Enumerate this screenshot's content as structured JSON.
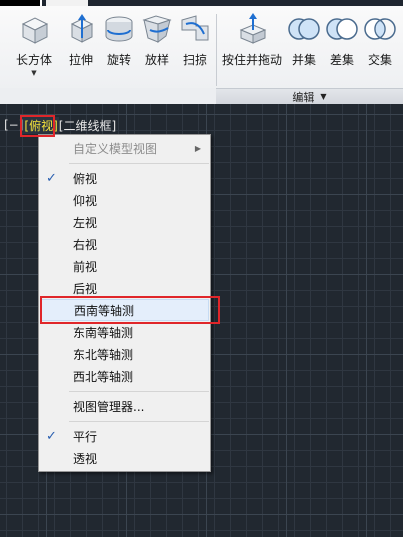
{
  "ribbon": {
    "buttons": [
      {
        "label": "长方体",
        "icon": "box-icon"
      },
      {
        "label": "拉伸",
        "icon": "extrude-icon"
      },
      {
        "label": "旋转",
        "icon": "revolve-icon"
      },
      {
        "label": "放样",
        "icon": "loft-icon"
      },
      {
        "label": "扫掠",
        "icon": "sweep-icon"
      },
      {
        "label": "按住并拖动",
        "icon": "presspull-icon"
      },
      {
        "label": "并集",
        "icon": "union-icon"
      },
      {
        "label": "差集",
        "icon": "subtract-icon"
      },
      {
        "label": "交集",
        "icon": "intersect-icon"
      }
    ],
    "panel_title": "编辑"
  },
  "viewport": {
    "control": "[−]",
    "view": "[俯视]",
    "visual_style": "[二维线框]"
  },
  "menu": {
    "items": [
      {
        "label": "自定义模型视图",
        "checked": false,
        "submenu": true,
        "disabled": true
      },
      {
        "label": "俯视",
        "checked": true
      },
      {
        "label": "仰视",
        "checked": false
      },
      {
        "label": "左视",
        "checked": false
      },
      {
        "label": "右视",
        "checked": false
      },
      {
        "label": "前视",
        "checked": false
      },
      {
        "label": "后视",
        "checked": false
      },
      {
        "label": "西南等轴测",
        "checked": false,
        "highlighted": true
      },
      {
        "label": "东南等轴测",
        "checked": false
      },
      {
        "label": "东北等轴测",
        "checked": false
      },
      {
        "label": "西北等轴测",
        "checked": false
      },
      {
        "label": "视图管理器...",
        "checked": false
      },
      {
        "label": "平行",
        "checked": true
      },
      {
        "label": "透视",
        "checked": false
      }
    ],
    "check_glyph": "✓",
    "submenu_glyph": "▶"
  },
  "colors": {
    "viewport_bg": "#212830",
    "highlight_box": "#e0262a",
    "view_label": "#f5e23c",
    "check": "#2a5fb0"
  }
}
